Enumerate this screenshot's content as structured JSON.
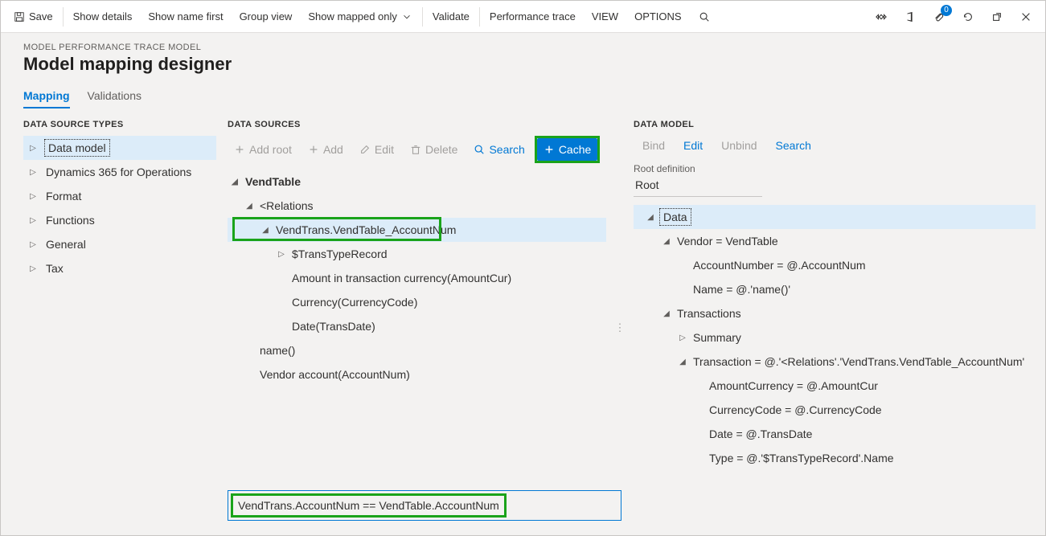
{
  "cmdbar": {
    "save": "Save",
    "show_details": "Show details",
    "show_name_first": "Show name first",
    "group_view": "Group view",
    "show_mapped_only": "Show mapped only",
    "validate": "Validate",
    "performance_trace": "Performance trace",
    "view": "VIEW",
    "options": "OPTIONS",
    "badge_count": "0"
  },
  "page": {
    "overtitle": "MODEL PERFORMANCE TRACE MODEL",
    "title": "Model mapping designer"
  },
  "tabs": {
    "mapping": "Mapping",
    "validations": "Validations"
  },
  "dst": {
    "heading": "DATA SOURCE TYPES",
    "items": [
      "Data model",
      "Dynamics 365 for Operations",
      "Format",
      "Functions",
      "General",
      "Tax"
    ]
  },
  "ds": {
    "heading": "DATA SOURCES",
    "toolbar": {
      "add_root": "Add root",
      "add": "Add",
      "edit": "Edit",
      "delete": "Delete",
      "search": "Search",
      "cache": "Cache"
    },
    "tree": {
      "vendtable": "VendTable",
      "relations": "<Relations",
      "vendtrans": "VendTrans.VendTable_AccountNum",
      "transtype": "$TransTypeRecord",
      "amount": "Amount in transaction currency(AmountCur)",
      "currency": "Currency(CurrencyCode)",
      "date": "Date(TransDate)",
      "name": "name()",
      "vendoracc": "Vendor account(AccountNum)"
    },
    "formula": "VendTrans.AccountNum == VendTable.AccountNum"
  },
  "dm": {
    "heading": "DATA MODEL",
    "toolbar": {
      "bind": "Bind",
      "edit": "Edit",
      "unbind": "Unbind",
      "search": "Search"
    },
    "root_label": "Root definition",
    "root_value": "Root",
    "tree": {
      "data": "Data",
      "vendor": "Vendor = VendTable",
      "accnum": "AccountNumber = @.AccountNum",
      "name": "Name = @.'name()'",
      "transactions": "Transactions",
      "summary": "Summary",
      "transaction": "Transaction = @.'<Relations'.'VendTrans.VendTable_AccountNum'",
      "amountcur": "AmountCurrency = @.AmountCur",
      "currencycode": "CurrencyCode = @.CurrencyCode",
      "dateval": "Date = @.TransDate",
      "type": "Type = @.'$TransTypeRecord'.Name"
    }
  }
}
